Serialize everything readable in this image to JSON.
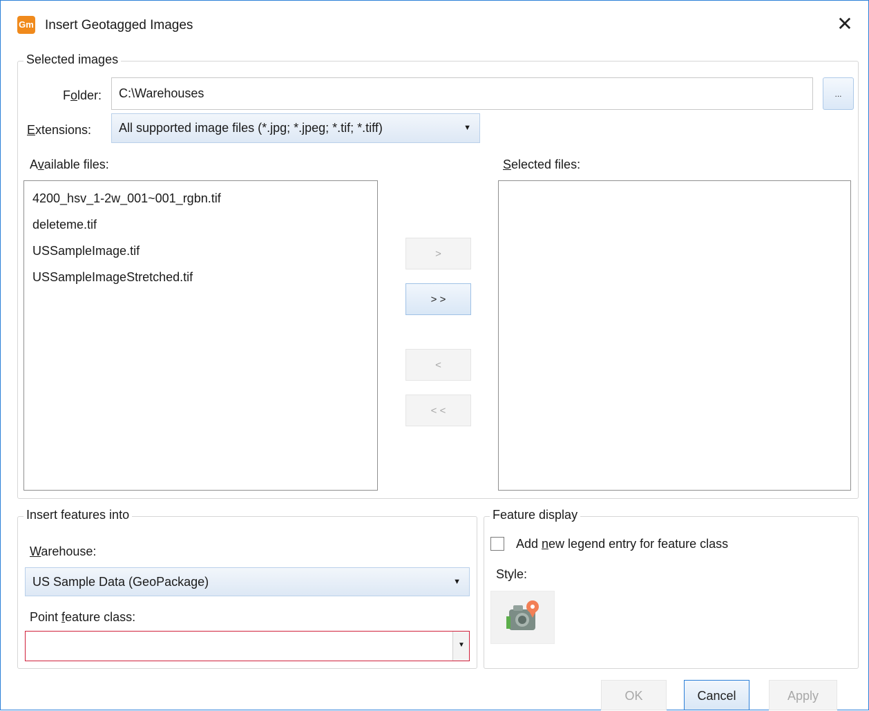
{
  "window": {
    "title": "Insert Geotagged Images",
    "app_icon_text": "Gm",
    "close_symbol": "✕"
  },
  "selected_images": {
    "legend": "Selected images",
    "folder_label_pre": "F",
    "folder_label_key": "o",
    "folder_label_post": "lder:",
    "folder_value": "C:\\Warehouses",
    "browse_label": "...",
    "extensions_label_key": "E",
    "extensions_label_post": "xtensions:",
    "extensions_value": "All supported image files (*.jpg; *.jpeg; *.tif; *.tiff)",
    "available_label_pre": "A",
    "available_label_key": "v",
    "available_label_post": "ailable files:",
    "selected_label_key": "S",
    "selected_label_post": "elected files:",
    "available_files": [
      "4200_hsv_1-2w_001~001_rgbn.tif",
      "deleteme.tif",
      "USSampleImage.tif",
      "USSampleImageStretched.tif"
    ],
    "selected_files": [],
    "move_buttons": {
      "add_one": ">",
      "add_all": "> >",
      "remove_one": "<",
      "remove_all": "< <"
    }
  },
  "insert_features": {
    "legend": "Insert features into",
    "warehouse_label_key": "W",
    "warehouse_label_post": "arehouse:",
    "warehouse_value": "US Sample Data (GeoPackage)",
    "feature_class_label_pre": "Point ",
    "feature_class_label_key": "f",
    "feature_class_label_post": "eature class:",
    "feature_class_value": ""
  },
  "feature_display": {
    "legend": "Feature display",
    "add_legend_pre": "Add ",
    "add_legend_key": "n",
    "add_legend_post": "ew legend entry for feature class",
    "add_legend_checked": false,
    "style_label": "Style:",
    "style_icon": "camera-pin-icon"
  },
  "footer": {
    "ok": "OK",
    "cancel": "Cancel",
    "apply": "Apply"
  },
  "colors": {
    "accent": "#2b7fd8",
    "error_border": "#d0203a",
    "app_icon": "#f08a1c"
  }
}
